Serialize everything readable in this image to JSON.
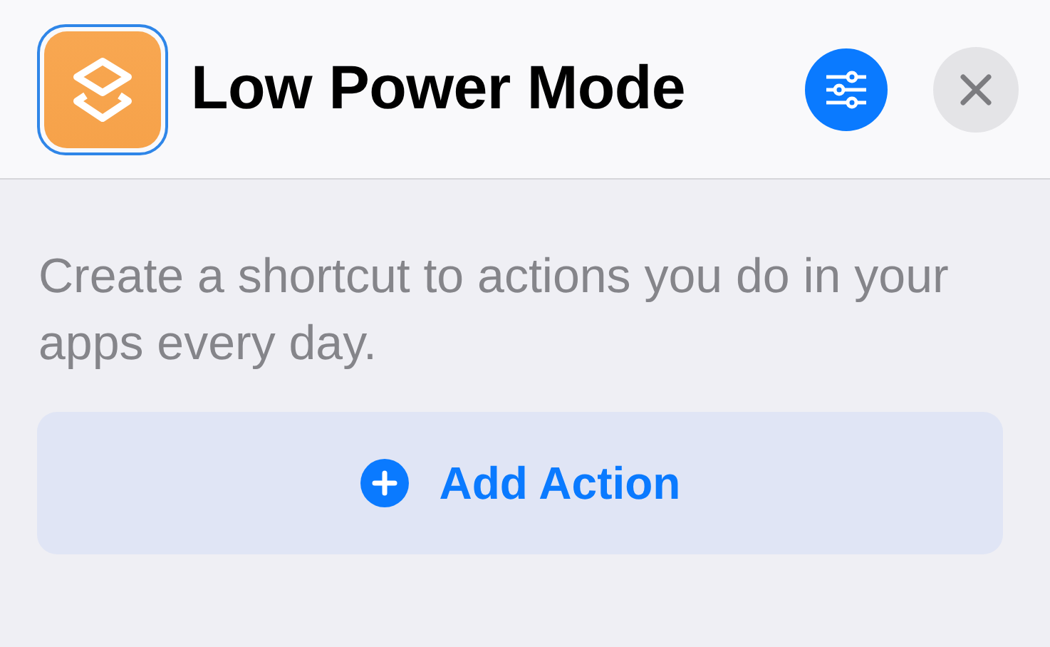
{
  "header": {
    "title": "Low Power Mode",
    "icon_selected": true
  },
  "description": "Create a shortcut to actions you do in your apps every day.",
  "add_button": {
    "label": "Add Action"
  }
}
